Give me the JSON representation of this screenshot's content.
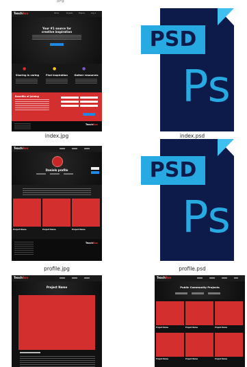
{
  "files": [
    {
      "name": "index.jpg"
    },
    {
      "name": "index.psd"
    },
    {
      "name": "profile.jpg"
    },
    {
      "name": "profile.psd"
    },
    {
      "name": ""
    },
    {
      "name": ""
    }
  ],
  "top_partial": {
    "left": "jpg",
    "right": ""
  },
  "mockup_index": {
    "logo_a": "Teach",
    "logo_b": "Box",
    "nav": [
      "Home",
      "Projects",
      "Explore",
      "Log in"
    ],
    "hero_title": "Your #1 source for",
    "hero_title2": "creative inspiration",
    "features": [
      "Sharing is caring",
      "Find inspiration",
      "Gather resources"
    ],
    "benefits_title": "Benefits of joining"
  },
  "mockup_profile": {
    "logo_a": "Teach",
    "logo_b": "Box",
    "profile_title": "Daniels profile",
    "projects": [
      "Project Name",
      "Project Name",
      "Project Name"
    ]
  },
  "mockup_project": {
    "logo_a": "Teach",
    "logo_b": "Box",
    "title": "Project Name"
  },
  "mockup_community": {
    "logo_a": "Teach",
    "logo_b": "Box",
    "title": "Public Community Projects",
    "projects": [
      "Project Name",
      "Project Name",
      "Project Name",
      "Project Name",
      "Project Name",
      "Project Name"
    ]
  },
  "psd": {
    "label": "PSD",
    "logo": "Ps"
  },
  "colors": {
    "accent": "#d32f2f",
    "psd_blue": "#27a9e1",
    "psd_navy": "#0d1b4a"
  }
}
